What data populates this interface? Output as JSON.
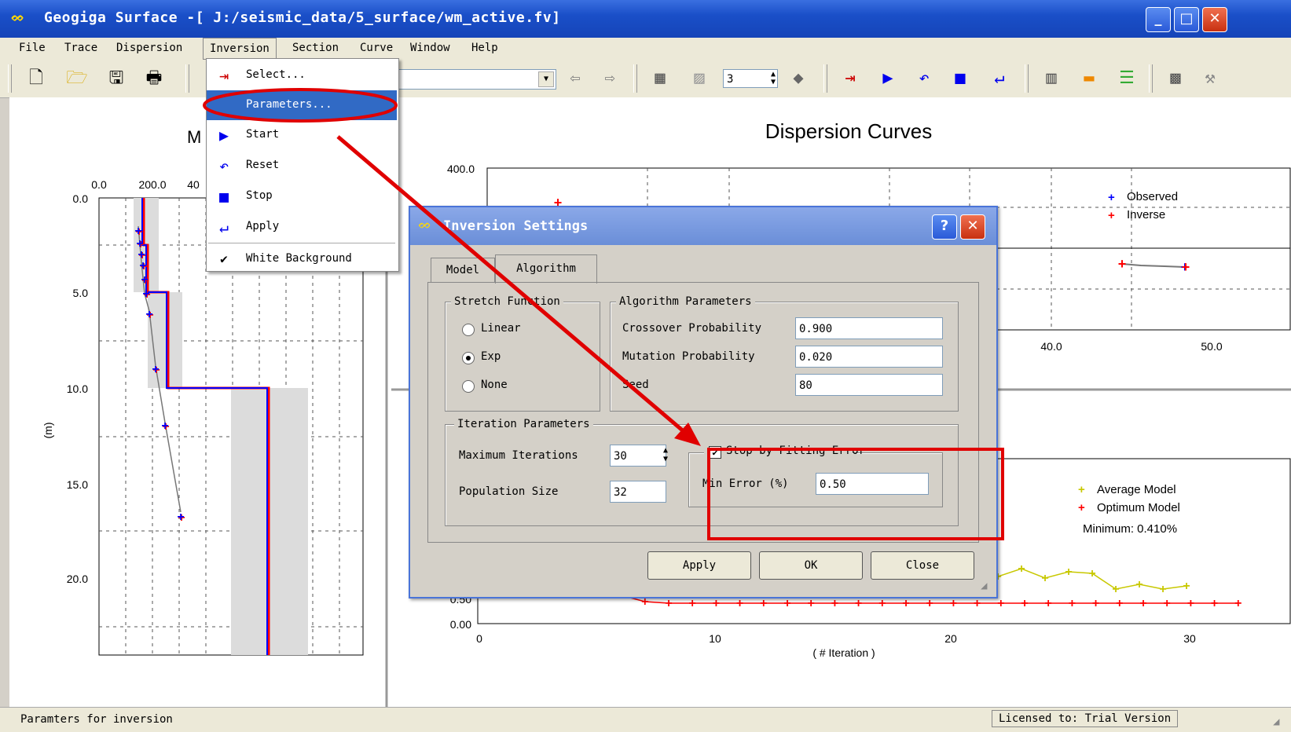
{
  "window": {
    "title": "Geogiga Surface -[ J:/seismic_data/5_surface/wm_active.fv]",
    "min": "_",
    "max": "□",
    "close": "✕"
  },
  "menubar": [
    "File",
    "Trace",
    "Dispersion",
    "Inversion",
    "Section",
    "Curve",
    "Window",
    "Help"
  ],
  "toolbar": {
    "spin_value": "3"
  },
  "inversion_menu": {
    "items": [
      {
        "label": "Select...",
        "icon": "select-icon"
      },
      {
        "label": "Parameters...",
        "icon": ""
      },
      {
        "label": "Start",
        "icon": "play-icon"
      },
      {
        "label": "Reset",
        "icon": "reset-icon"
      },
      {
        "label": "Stop",
        "icon": "stop-icon"
      },
      {
        "label": "Apply",
        "icon": "enter-icon"
      },
      {
        "label": "White Background",
        "icon": "check-icon"
      }
    ]
  },
  "dialog": {
    "title": "Inversion Settings",
    "help": "?",
    "close": "✕",
    "tabs": [
      "Model",
      "Algorithm"
    ],
    "stretch_function": {
      "label": "Stretch Function",
      "options": [
        "Linear",
        "Exp",
        "None"
      ],
      "selected": "Exp"
    },
    "algorithm_parameters": {
      "label": "Algorithm Parameters",
      "crossover_label": "Crossover Probability",
      "crossover_value": "0.900",
      "mutation_label": "Mutation Probability",
      "mutation_value": "0.020",
      "seed_label": "Seed",
      "seed_value": "80"
    },
    "iteration_parameters": {
      "label": "Iteration Parameters",
      "max_iter_label": "Maximum Iterations",
      "max_iter_value": "30",
      "pop_label": "Population Size",
      "pop_value": "32"
    },
    "stop_by_error": {
      "label": "Stop by Fitting Error",
      "checked": true,
      "min_error_label": "Min Error (%)",
      "min_error_value": "0.50"
    },
    "buttons": {
      "apply": "Apply",
      "ok": "OK",
      "close": "Close"
    }
  },
  "left_plot": {
    "title_fragment": "M",
    "x_ticks": [
      "0.0",
      "200.0",
      "40"
    ],
    "y_ticks": [
      "0.0",
      "5.0",
      "10.0",
      "15.0",
      "20.0"
    ],
    "ylabel": "(m)"
  },
  "dispersion_plot": {
    "title": "Dispersion Curves",
    "y_tick_top": "400.0",
    "x_ticks": [
      "40.0",
      "50.0"
    ],
    "legend": [
      "Observed",
      "Inverse"
    ]
  },
  "error_plot": {
    "y_ticks": [
      "0.50",
      "0.00"
    ],
    "x_ticks": [
      "0",
      "10",
      "20",
      "30"
    ],
    "xlabel": "( # Iteration )",
    "legend": [
      "Average Model",
      "Optimum Model"
    ],
    "minimum_text": "Minimum: 0.410%"
  },
  "status": {
    "left": "Paramters for inversion",
    "right": "Licensed to: Trial Version"
  },
  "colors": {
    "observed": "#0000ff",
    "inverse": "#ff0000",
    "average": "#c8c800",
    "annotation": "#e00000"
  }
}
